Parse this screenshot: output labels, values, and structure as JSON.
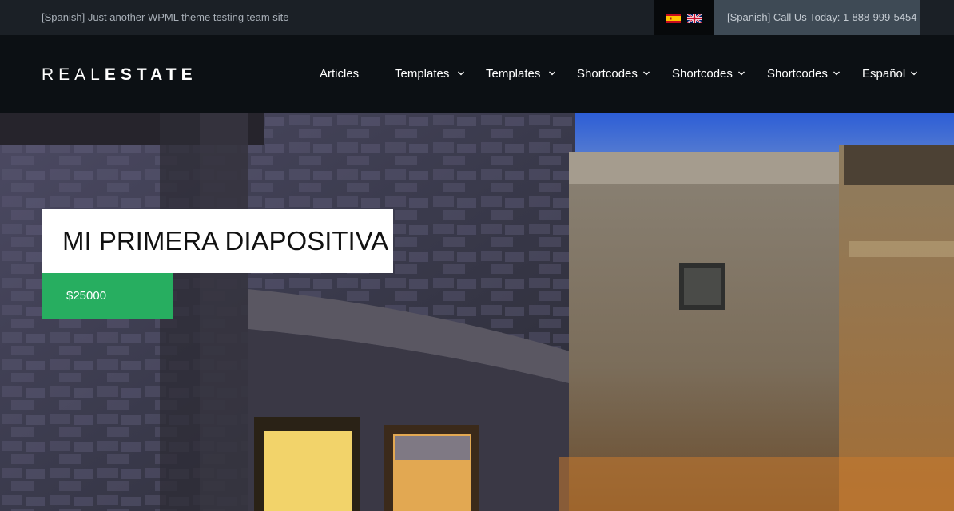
{
  "topbar": {
    "tagline": "[Spanish] Just another WPML theme testing team site",
    "flags": [
      {
        "name": "spanish-flag-icon",
        "label": "Español"
      },
      {
        "name": "english-flag-icon",
        "label": "English"
      }
    ],
    "call_text": "[Spanish] Call Us Today: 1-888-999-5454"
  },
  "header": {
    "logo": {
      "light": "REAL",
      "bold": "ESTATE"
    },
    "nav": [
      {
        "label": "Articles",
        "has_dropdown": false
      },
      {
        "label": "Templates",
        "has_dropdown": true
      },
      {
        "label": "Templates",
        "has_dropdown": true
      },
      {
        "label": "Shortcodes",
        "has_dropdown": true
      },
      {
        "label": "Shortcodes",
        "has_dropdown": true
      },
      {
        "label": "Shortcodes",
        "has_dropdown": true
      },
      {
        "label": "Español",
        "has_dropdown": true
      }
    ]
  },
  "slider": {
    "title": "MI PRIMERA DIAPOSITIVA",
    "price": "$25000"
  },
  "colors": {
    "topbar_bg": "#1b2026",
    "header_bg": "#0c1014",
    "call_bg": "#3e4a55",
    "price_bg": "#27ae60"
  }
}
